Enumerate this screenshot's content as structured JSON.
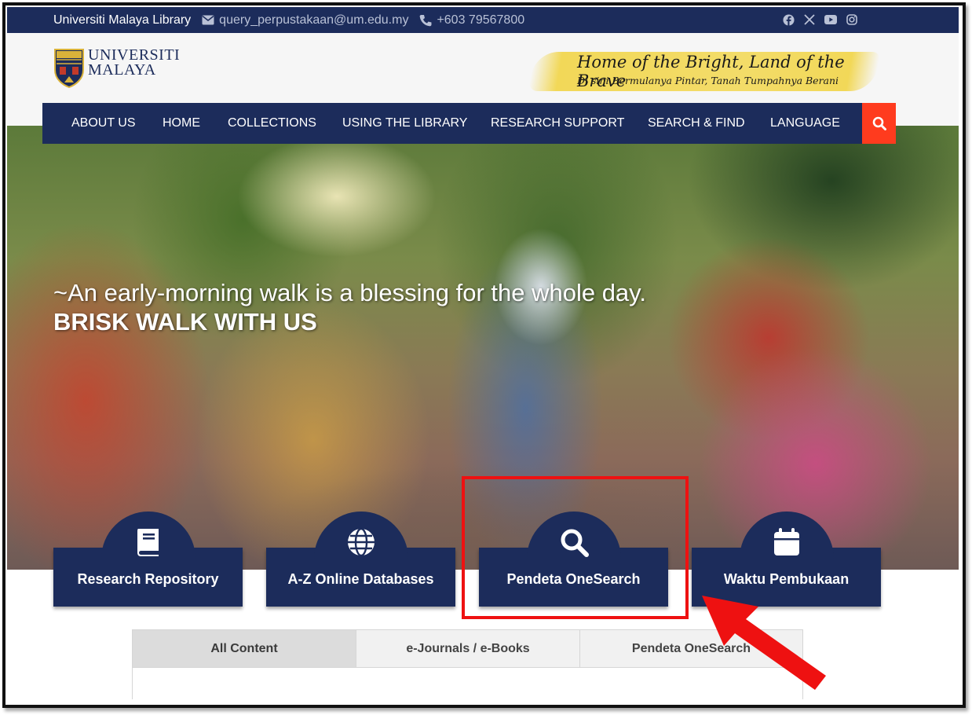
{
  "topbar": {
    "site_name": "Universiti Malaya Library",
    "email": "query_perpustakaan@um.edu.my",
    "phone": "+603 79567800",
    "social": [
      "facebook-icon",
      "x-icon",
      "youtube-icon",
      "instagram-icon"
    ]
  },
  "header": {
    "logo_line1": "UNIVERSITI",
    "logo_line2": "MALAYA",
    "tagline_line1": "Home of the Bright, Land of the Brave",
    "tagline_line2": "Di sini Bermulanya Pintar, Tanah Tumpahnya Berani"
  },
  "nav": {
    "items": [
      "ABOUT US",
      "HOME",
      "COLLECTIONS",
      "USING THE LIBRARY",
      "RESEARCH SUPPORT",
      "SEARCH & FIND",
      "LANGUAGE"
    ]
  },
  "hero": {
    "line1": "~An early-morning walk is a blessing for the whole day.",
    "line2": "BRISK WALK WITH US"
  },
  "quick_links": [
    {
      "label": "Research Repository",
      "icon": "book-icon"
    },
    {
      "label": "A-Z Online Databases",
      "icon": "globe-icon"
    },
    {
      "label": "Pendeta OneSearch",
      "icon": "search-icon"
    },
    {
      "label": "Waktu Pembukaan",
      "icon": "calendar-icon"
    }
  ],
  "tabs": [
    "All Content",
    "e-Journals / e-Books",
    "Pendeta OneSearch"
  ],
  "colors": {
    "navy": "#1c2c5b",
    "accent_red": "#ff3b1e",
    "highlight_red": "#ee1111",
    "tagline_yellow": "#f2d858"
  }
}
